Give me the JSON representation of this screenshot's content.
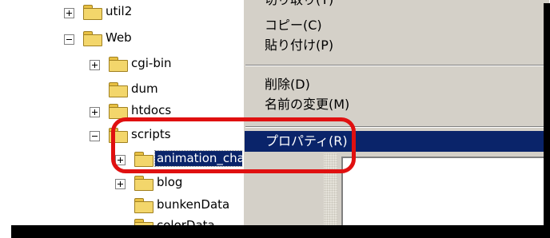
{
  "tree": {
    "items": [
      {
        "label": "util2",
        "toggle": "+"
      },
      {
        "label": "Web",
        "toggle": "-"
      },
      {
        "label": "cgi-bin",
        "toggle": "+"
      },
      {
        "label": "dum",
        "toggle": ""
      },
      {
        "label": "htdocs",
        "toggle": "+"
      },
      {
        "label": "scripts",
        "toggle": "-"
      },
      {
        "label": "animation_chat",
        "toggle": "+",
        "selected": true
      },
      {
        "label": "blog",
        "toggle": "+"
      },
      {
        "label": "bunkenData",
        "toggle": ""
      },
      {
        "label": "colorData",
        "toggle": ""
      }
    ]
  },
  "context_menu": {
    "cut": "切り取り(T)",
    "copy": "コピー(C)",
    "paste": "貼り付け(P)",
    "delete": "削除(D)",
    "rename": "名前の変更(M)",
    "properties": "プロパティ(R)"
  },
  "colors": {
    "selection": "#0a246a",
    "menu_bg": "#d4d0c8",
    "callout": "#e01010",
    "folder": "#f3d66b"
  },
  "icons": [
    "expand-icon",
    "collapse-icon",
    "folder-icon"
  ]
}
